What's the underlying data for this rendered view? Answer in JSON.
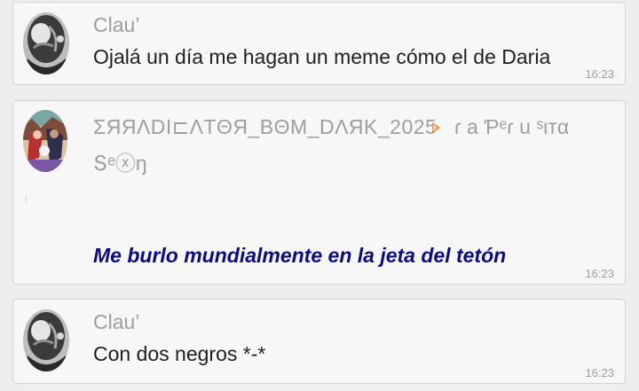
{
  "messages": [
    {
      "sender": "Clau’",
      "text": "Ojalá un día me hagan un meme cómo el de Daria",
      "time": "16:23"
    },
    {
      "sender": "ΣЯЯΛDI⊏ΛTΘЯ_BΘM_DΛЯK_2025",
      "sender_extra": "ɾ a Ƥᵉɾ u ˢιтα",
      "sender_extra2": "Տᵉⓧŋ",
      "text": "Me burlo mundialmente en la jeta del tetón",
      "time": "16:23"
    },
    {
      "sender": "Clau’",
      "text": "Con dos negros *-*",
      "time": "16:23"
    }
  ],
  "colors": {
    "background": "#eeeeee",
    "card": "#f7f7f7",
    "sender": "#9e9e9e",
    "highlight_text": "#0b0b8a",
    "badge": "#ff8a1f"
  }
}
